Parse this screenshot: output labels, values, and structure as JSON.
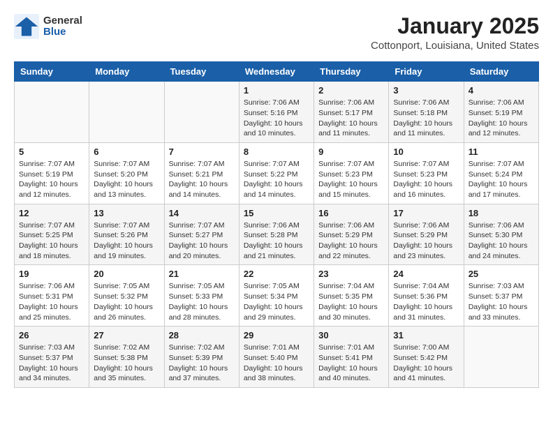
{
  "logo": {
    "general": "General",
    "blue": "Blue"
  },
  "title": "January 2025",
  "subtitle": "Cottonport, Louisiana, United States",
  "days_of_week": [
    "Sunday",
    "Monday",
    "Tuesday",
    "Wednesday",
    "Thursday",
    "Friday",
    "Saturday"
  ],
  "weeks": [
    [
      {
        "day": "",
        "info": ""
      },
      {
        "day": "",
        "info": ""
      },
      {
        "day": "",
        "info": ""
      },
      {
        "day": "1",
        "info": "Sunrise: 7:06 AM\nSunset: 5:16 PM\nDaylight: 10 hours and 10 minutes."
      },
      {
        "day": "2",
        "info": "Sunrise: 7:06 AM\nSunset: 5:17 PM\nDaylight: 10 hours and 11 minutes."
      },
      {
        "day": "3",
        "info": "Sunrise: 7:06 AM\nSunset: 5:18 PM\nDaylight: 10 hours and 11 minutes."
      },
      {
        "day": "4",
        "info": "Sunrise: 7:06 AM\nSunset: 5:19 PM\nDaylight: 10 hours and 12 minutes."
      }
    ],
    [
      {
        "day": "5",
        "info": "Sunrise: 7:07 AM\nSunset: 5:19 PM\nDaylight: 10 hours and 12 minutes."
      },
      {
        "day": "6",
        "info": "Sunrise: 7:07 AM\nSunset: 5:20 PM\nDaylight: 10 hours and 13 minutes."
      },
      {
        "day": "7",
        "info": "Sunrise: 7:07 AM\nSunset: 5:21 PM\nDaylight: 10 hours and 14 minutes."
      },
      {
        "day": "8",
        "info": "Sunrise: 7:07 AM\nSunset: 5:22 PM\nDaylight: 10 hours and 14 minutes."
      },
      {
        "day": "9",
        "info": "Sunrise: 7:07 AM\nSunset: 5:23 PM\nDaylight: 10 hours and 15 minutes."
      },
      {
        "day": "10",
        "info": "Sunrise: 7:07 AM\nSunset: 5:23 PM\nDaylight: 10 hours and 16 minutes."
      },
      {
        "day": "11",
        "info": "Sunrise: 7:07 AM\nSunset: 5:24 PM\nDaylight: 10 hours and 17 minutes."
      }
    ],
    [
      {
        "day": "12",
        "info": "Sunrise: 7:07 AM\nSunset: 5:25 PM\nDaylight: 10 hours and 18 minutes."
      },
      {
        "day": "13",
        "info": "Sunrise: 7:07 AM\nSunset: 5:26 PM\nDaylight: 10 hours and 19 minutes."
      },
      {
        "day": "14",
        "info": "Sunrise: 7:07 AM\nSunset: 5:27 PM\nDaylight: 10 hours and 20 minutes."
      },
      {
        "day": "15",
        "info": "Sunrise: 7:06 AM\nSunset: 5:28 PM\nDaylight: 10 hours and 21 minutes."
      },
      {
        "day": "16",
        "info": "Sunrise: 7:06 AM\nSunset: 5:29 PM\nDaylight: 10 hours and 22 minutes."
      },
      {
        "day": "17",
        "info": "Sunrise: 7:06 AM\nSunset: 5:29 PM\nDaylight: 10 hours and 23 minutes."
      },
      {
        "day": "18",
        "info": "Sunrise: 7:06 AM\nSunset: 5:30 PM\nDaylight: 10 hours and 24 minutes."
      }
    ],
    [
      {
        "day": "19",
        "info": "Sunrise: 7:06 AM\nSunset: 5:31 PM\nDaylight: 10 hours and 25 minutes."
      },
      {
        "day": "20",
        "info": "Sunrise: 7:05 AM\nSunset: 5:32 PM\nDaylight: 10 hours and 26 minutes."
      },
      {
        "day": "21",
        "info": "Sunrise: 7:05 AM\nSunset: 5:33 PM\nDaylight: 10 hours and 28 minutes."
      },
      {
        "day": "22",
        "info": "Sunrise: 7:05 AM\nSunset: 5:34 PM\nDaylight: 10 hours and 29 minutes."
      },
      {
        "day": "23",
        "info": "Sunrise: 7:04 AM\nSunset: 5:35 PM\nDaylight: 10 hours and 30 minutes."
      },
      {
        "day": "24",
        "info": "Sunrise: 7:04 AM\nSunset: 5:36 PM\nDaylight: 10 hours and 31 minutes."
      },
      {
        "day": "25",
        "info": "Sunrise: 7:03 AM\nSunset: 5:37 PM\nDaylight: 10 hours and 33 minutes."
      }
    ],
    [
      {
        "day": "26",
        "info": "Sunrise: 7:03 AM\nSunset: 5:37 PM\nDaylight: 10 hours and 34 minutes."
      },
      {
        "day": "27",
        "info": "Sunrise: 7:02 AM\nSunset: 5:38 PM\nDaylight: 10 hours and 35 minutes."
      },
      {
        "day": "28",
        "info": "Sunrise: 7:02 AM\nSunset: 5:39 PM\nDaylight: 10 hours and 37 minutes."
      },
      {
        "day": "29",
        "info": "Sunrise: 7:01 AM\nSunset: 5:40 PM\nDaylight: 10 hours and 38 minutes."
      },
      {
        "day": "30",
        "info": "Sunrise: 7:01 AM\nSunset: 5:41 PM\nDaylight: 10 hours and 40 minutes."
      },
      {
        "day": "31",
        "info": "Sunrise: 7:00 AM\nSunset: 5:42 PM\nDaylight: 10 hours and 41 minutes."
      },
      {
        "day": "",
        "info": ""
      }
    ]
  ]
}
